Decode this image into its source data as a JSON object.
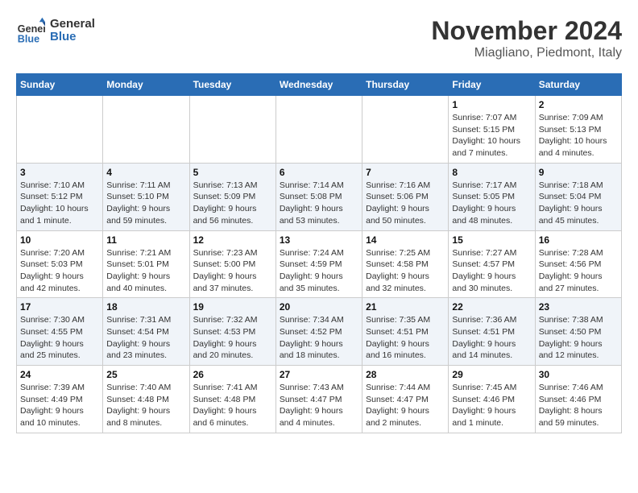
{
  "header": {
    "logo_line1": "General",
    "logo_line2": "Blue",
    "month_year": "November 2024",
    "location": "Miagliano, Piedmont, Italy"
  },
  "columns": [
    "Sunday",
    "Monday",
    "Tuesday",
    "Wednesday",
    "Thursday",
    "Friday",
    "Saturday"
  ],
  "weeks": [
    [
      {
        "day": "",
        "info": ""
      },
      {
        "day": "",
        "info": ""
      },
      {
        "day": "",
        "info": ""
      },
      {
        "day": "",
        "info": ""
      },
      {
        "day": "",
        "info": ""
      },
      {
        "day": "1",
        "info": "Sunrise: 7:07 AM\nSunset: 5:15 PM\nDaylight: 10 hours and 7 minutes."
      },
      {
        "day": "2",
        "info": "Sunrise: 7:09 AM\nSunset: 5:13 PM\nDaylight: 10 hours and 4 minutes."
      }
    ],
    [
      {
        "day": "3",
        "info": "Sunrise: 7:10 AM\nSunset: 5:12 PM\nDaylight: 10 hours and 1 minute."
      },
      {
        "day": "4",
        "info": "Sunrise: 7:11 AM\nSunset: 5:10 PM\nDaylight: 9 hours and 59 minutes."
      },
      {
        "day": "5",
        "info": "Sunrise: 7:13 AM\nSunset: 5:09 PM\nDaylight: 9 hours and 56 minutes."
      },
      {
        "day": "6",
        "info": "Sunrise: 7:14 AM\nSunset: 5:08 PM\nDaylight: 9 hours and 53 minutes."
      },
      {
        "day": "7",
        "info": "Sunrise: 7:16 AM\nSunset: 5:06 PM\nDaylight: 9 hours and 50 minutes."
      },
      {
        "day": "8",
        "info": "Sunrise: 7:17 AM\nSunset: 5:05 PM\nDaylight: 9 hours and 48 minutes."
      },
      {
        "day": "9",
        "info": "Sunrise: 7:18 AM\nSunset: 5:04 PM\nDaylight: 9 hours and 45 minutes."
      }
    ],
    [
      {
        "day": "10",
        "info": "Sunrise: 7:20 AM\nSunset: 5:03 PM\nDaylight: 9 hours and 42 minutes."
      },
      {
        "day": "11",
        "info": "Sunrise: 7:21 AM\nSunset: 5:01 PM\nDaylight: 9 hours and 40 minutes."
      },
      {
        "day": "12",
        "info": "Sunrise: 7:23 AM\nSunset: 5:00 PM\nDaylight: 9 hours and 37 minutes."
      },
      {
        "day": "13",
        "info": "Sunrise: 7:24 AM\nSunset: 4:59 PM\nDaylight: 9 hours and 35 minutes."
      },
      {
        "day": "14",
        "info": "Sunrise: 7:25 AM\nSunset: 4:58 PM\nDaylight: 9 hours and 32 minutes."
      },
      {
        "day": "15",
        "info": "Sunrise: 7:27 AM\nSunset: 4:57 PM\nDaylight: 9 hours and 30 minutes."
      },
      {
        "day": "16",
        "info": "Sunrise: 7:28 AM\nSunset: 4:56 PM\nDaylight: 9 hours and 27 minutes."
      }
    ],
    [
      {
        "day": "17",
        "info": "Sunrise: 7:30 AM\nSunset: 4:55 PM\nDaylight: 9 hours and 25 minutes."
      },
      {
        "day": "18",
        "info": "Sunrise: 7:31 AM\nSunset: 4:54 PM\nDaylight: 9 hours and 23 minutes."
      },
      {
        "day": "19",
        "info": "Sunrise: 7:32 AM\nSunset: 4:53 PM\nDaylight: 9 hours and 20 minutes."
      },
      {
        "day": "20",
        "info": "Sunrise: 7:34 AM\nSunset: 4:52 PM\nDaylight: 9 hours and 18 minutes."
      },
      {
        "day": "21",
        "info": "Sunrise: 7:35 AM\nSunset: 4:51 PM\nDaylight: 9 hours and 16 minutes."
      },
      {
        "day": "22",
        "info": "Sunrise: 7:36 AM\nSunset: 4:51 PM\nDaylight: 9 hours and 14 minutes."
      },
      {
        "day": "23",
        "info": "Sunrise: 7:38 AM\nSunset: 4:50 PM\nDaylight: 9 hours and 12 minutes."
      }
    ],
    [
      {
        "day": "24",
        "info": "Sunrise: 7:39 AM\nSunset: 4:49 PM\nDaylight: 9 hours and 10 minutes."
      },
      {
        "day": "25",
        "info": "Sunrise: 7:40 AM\nSunset: 4:48 PM\nDaylight: 9 hours and 8 minutes."
      },
      {
        "day": "26",
        "info": "Sunrise: 7:41 AM\nSunset: 4:48 PM\nDaylight: 9 hours and 6 minutes."
      },
      {
        "day": "27",
        "info": "Sunrise: 7:43 AM\nSunset: 4:47 PM\nDaylight: 9 hours and 4 minutes."
      },
      {
        "day": "28",
        "info": "Sunrise: 7:44 AM\nSunset: 4:47 PM\nDaylight: 9 hours and 2 minutes."
      },
      {
        "day": "29",
        "info": "Sunrise: 7:45 AM\nSunset: 4:46 PM\nDaylight: 9 hours and 1 minute."
      },
      {
        "day": "30",
        "info": "Sunrise: 7:46 AM\nSunset: 4:46 PM\nDaylight: 8 hours and 59 minutes."
      }
    ]
  ]
}
